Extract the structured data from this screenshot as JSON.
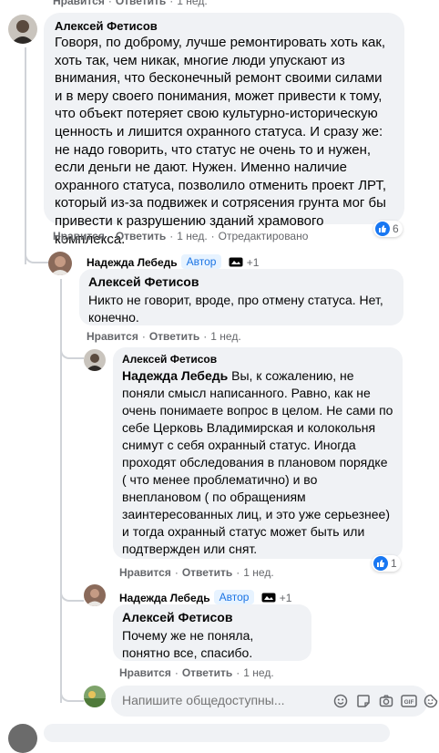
{
  "top_actions": {
    "like": "Нравится",
    "reply": "Ответить",
    "time": "1 нед."
  },
  "c1": {
    "author": "Алексей Фетисов",
    "text": "Говоря, по доброму, лучше ремонтировать хоть как, хоть так, чем никак, многие люди упускают из внимания, что бесконечный ремонт своими силами и в меру своего понимания, может привести к тому, что объект потеряет свою культурно-историческую ценность и лишится охранного статуса. И сразу же: не надо говорить, что статус не очень то и нужен, если деньги не дают. Нужен. Именно наличие охранного статуса, позволило отменить проект ЛРТ, который из-за подвижек и сотрясения грунта мог бы привести к разрушению зданий храмового комплекса.",
    "like": "Нравится",
    "reply": "Ответить",
    "time": "1 нед.",
    "edited": "Отредактировано",
    "reactions": "6"
  },
  "c2": {
    "author": "Надежда Лебедь",
    "badge": "Автор",
    "plus": "+1",
    "mention": "Алексей Фетисов",
    "text": "Никто не говорит, вроде, про отмену статуса. Нет, конечно.",
    "like": "Нравится",
    "reply": "Ответить",
    "time": "1 нед."
  },
  "c3": {
    "author": "Алексей Фетисов",
    "mention": "Надежда Лебедь",
    "text": " Вы, к сожалению, не поняли смысл написанного. Равно, как не очень понимаете вопрос в целом. Не сами по себе Церковь Владимирская и колокольня снимут с себя охранный статус. Иногда проходят обследования в плановом порядке ( что менее проблематично) и во внеплановом ( по обращениям заинтересованных лиц, и это уже серьезнее) и тогда охранный статус может быть или подтвержден или снят.",
    "like": "Нравится",
    "reply": "Ответить",
    "time": "1 нед.",
    "reactions": "1"
  },
  "c4": {
    "author": "Надежда Лебедь",
    "badge": "Автор",
    "plus": "+1",
    "mention": "Алексей Фетисов",
    "text": "Почему же не поняла, понятно все, спасибо.",
    "like": "Нравится",
    "reply": "Ответить",
    "time": "1 нед."
  },
  "reply_box": {
    "placeholder": "Напишите общедоступны..."
  },
  "icons": [
    "smile-icon",
    "sticker-icon",
    "camera-icon",
    "gif-icon",
    "sticker-face-icon"
  ],
  "colors": {
    "bubble": "#f0f2f5",
    "meta": "#65676b",
    "link": "#1b74e4",
    "like": "#1877f2"
  }
}
